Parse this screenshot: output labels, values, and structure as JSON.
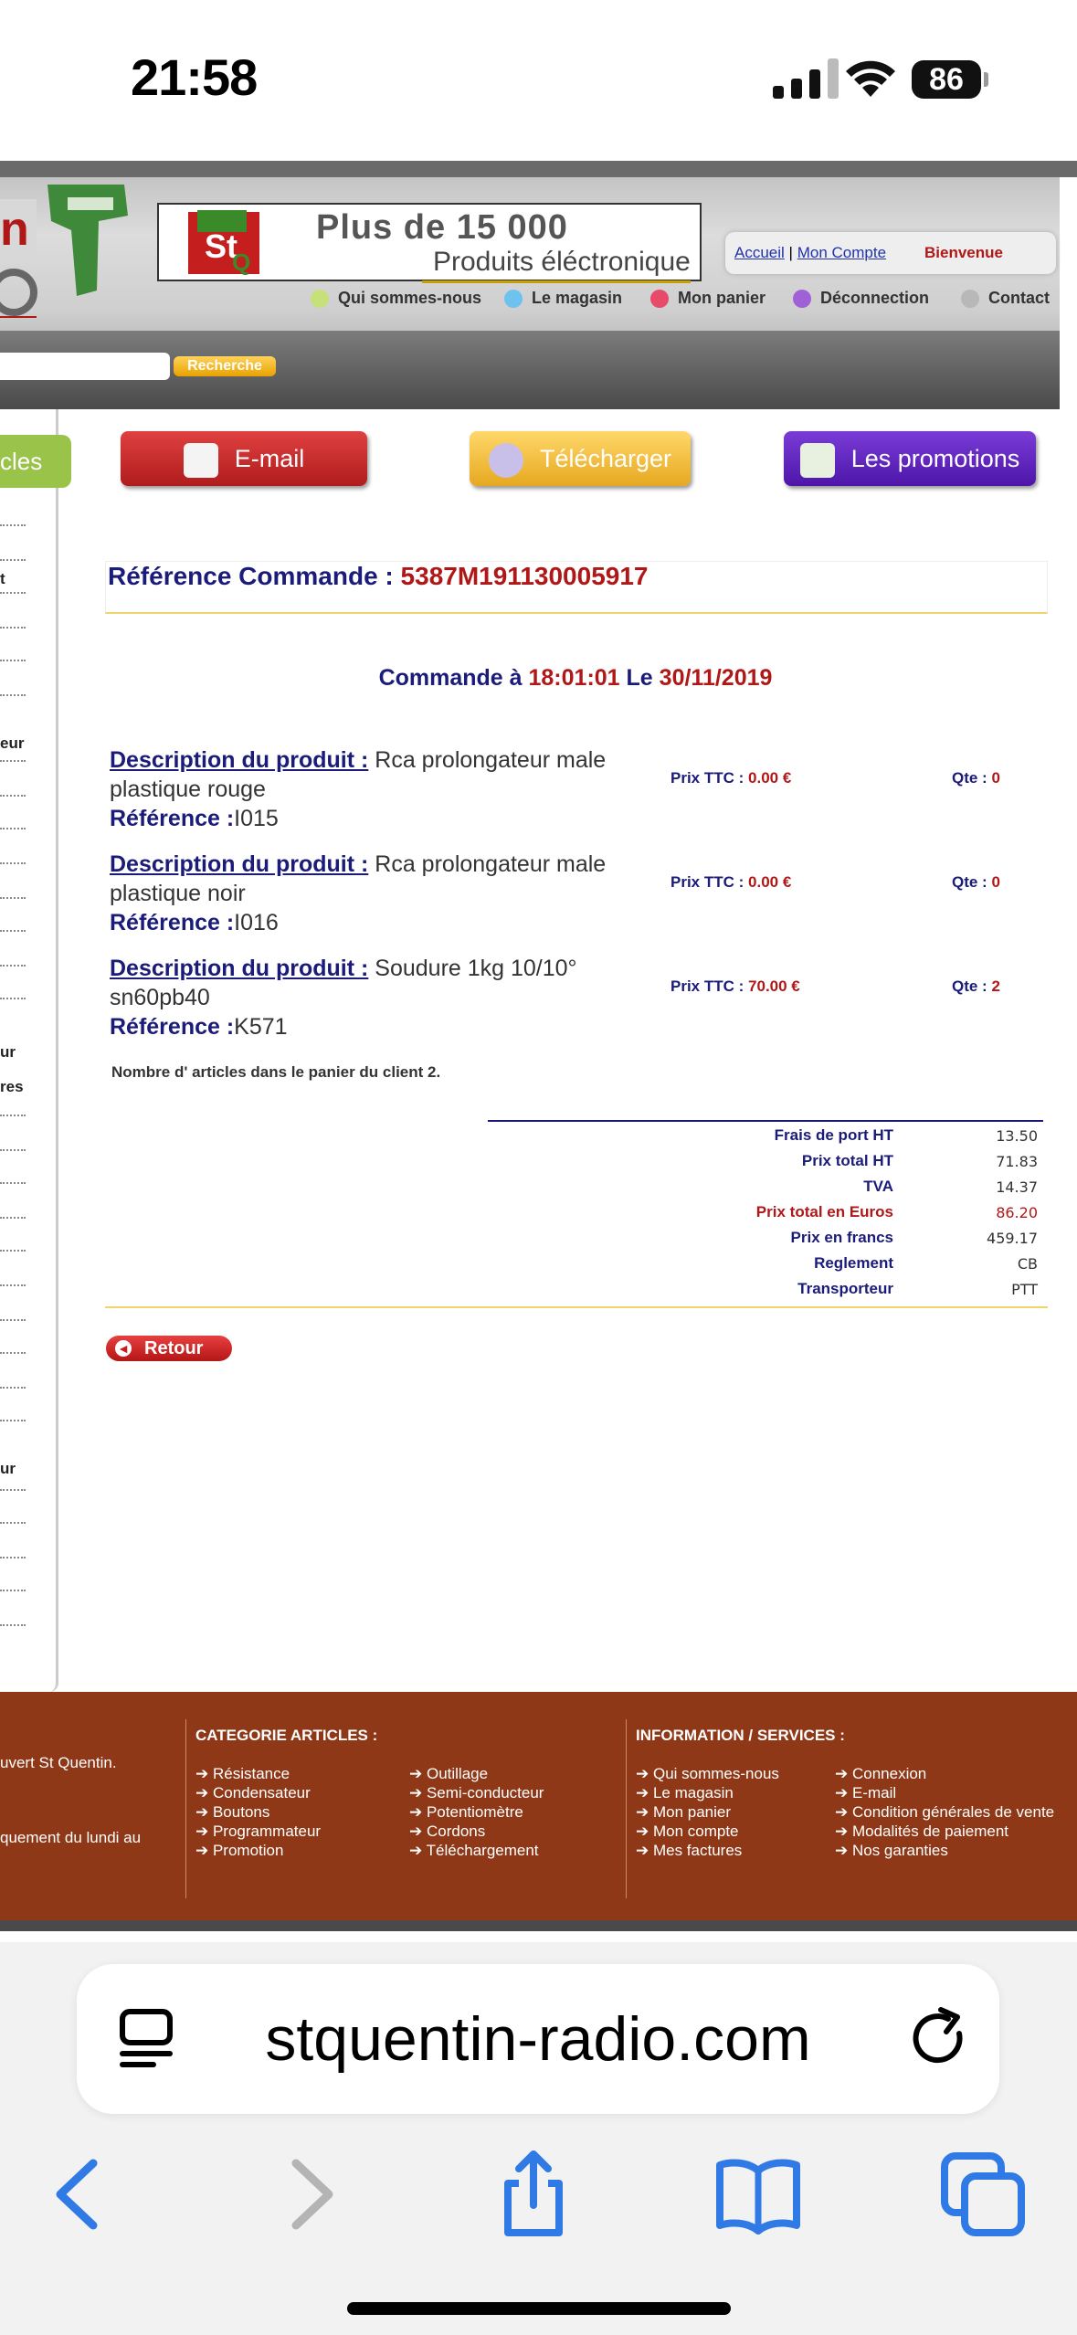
{
  "status": {
    "time": "21:58",
    "battery": "86"
  },
  "header": {
    "banner_line1": "Plus de 15 000",
    "banner_line2": "Produits éléctronique",
    "account_home": "Accueil",
    "account_sep": "|",
    "account_mine": "Mon Compte",
    "welcome": "Bienvenue",
    "nav": [
      {
        "label": "Qui sommes-nous",
        "color": "#c6e07a"
      },
      {
        "label": "Le magasin",
        "color": "#6ec3ee"
      },
      {
        "label": "Mon panier",
        "color": "#e84a6a"
      },
      {
        "label": "Déconnection",
        "color": "#a060d8"
      },
      {
        "label": "Contact",
        "color": "#b8b8b8"
      }
    ],
    "search_button": "Recherche"
  },
  "sidebar": {
    "tab_fragment": "cles",
    "frags": [
      "t",
      "eur",
      "ur",
      "res",
      "ur"
    ]
  },
  "actions": {
    "email": "E-mail",
    "download": "Télécharger",
    "promotions": "Les promotions"
  },
  "order": {
    "ref_label": "Référence Commande :",
    "ref_value": "5387M191130005917",
    "cmd_label1": "Commande à",
    "time": "18:01:01",
    "cmd_label2": "Le",
    "date": "30/11/2019",
    "products": [
      {
        "desc_label": "Description du produit :",
        "desc": "Rca prolongateur male plastique rouge",
        "ref_label": "Référence :",
        "ref": "I015",
        "price_label": "Prix TTC :",
        "price": "0.00 €",
        "qty_label": "Qte :",
        "qty": "0"
      },
      {
        "desc_label": "Description du produit :",
        "desc": "Rca prolongateur male plastique noir",
        "ref_label": "Référence :",
        "ref": "I016",
        "price_label": "Prix TTC :",
        "price": "0.00 €",
        "qty_label": "Qte :",
        "qty": "0"
      },
      {
        "desc_label": "Description du produit :",
        "desc": "Soudure 1kg 10/10° sn60pb40",
        "ref_label": "Référence :",
        "ref": "K571",
        "price_label": "Prix TTC :",
        "price": "70.00 €",
        "qty_label": "Qte :",
        "qty": "2"
      }
    ],
    "nb_articles": "Nombre d' articles dans le panier du client 2.",
    "totals": [
      {
        "label": "Frais de port HT",
        "value": "13.50"
      },
      {
        "label": "Prix total HT",
        "value": "71.83"
      },
      {
        "label": "TVA",
        "value": "14.37"
      },
      {
        "label": "Prix total en Euros",
        "value": "86.20"
      },
      {
        "label": "Prix en francs",
        "value": "459.17"
      },
      {
        "label": "Reglement",
        "value": "CB"
      },
      {
        "label": "Transporteur",
        "value": "PTT"
      }
    ],
    "back": "Retour"
  },
  "footer": {
    "frag1": "uvert St Quentin.",
    "frag2": "quement du lundi au",
    "cat_title": "CATEGORIE ARTICLES :",
    "cat_col1": [
      "Résistance",
      "Condensateur",
      "Boutons",
      "Programmateur",
      "Promotion"
    ],
    "cat_col2": [
      "Outillage",
      "Semi-conducteur",
      "Potentiomètre",
      "Cordons",
      "Téléchargement"
    ],
    "info_title": "INFORMATION / SERVICES :",
    "info_col1": [
      "Qui sommes-nous",
      "Le magasin",
      "Mon panier",
      "Mon compte",
      "Mes factures"
    ],
    "info_col2": [
      "Connexion",
      "E-mail",
      "Condition générales de vente",
      "Modalités de paiement",
      "Nos garanties"
    ]
  },
  "browser": {
    "url": "stquentin-radio.com"
  }
}
